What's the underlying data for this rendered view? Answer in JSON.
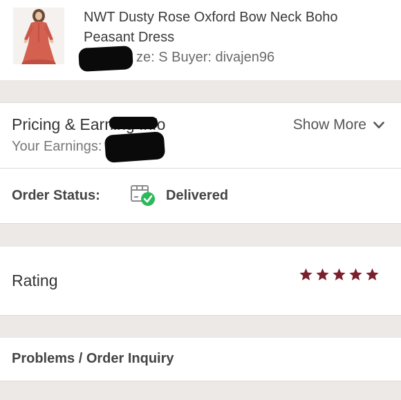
{
  "item": {
    "title": "NWT Dusty Rose Oxford Bow Neck Boho Peasant Dress",
    "meta_visible": "ze: S  Buyer: divajen96"
  },
  "pricing": {
    "title": "Pricing & Earning Info",
    "earnings_label": "Your Earnings:",
    "show_more": "Show More",
    "show_more_icon": "chevron-down-icon"
  },
  "status": {
    "label": "Order Status:",
    "value": "Delivered",
    "icon": "package-delivered-icon",
    "check_color": "#2eb85c"
  },
  "rating": {
    "label": "Rating",
    "stars": 5,
    "max_stars": 5,
    "star_color": "#7a1f2b"
  },
  "problems": {
    "label": "Problems / Order Inquiry"
  }
}
